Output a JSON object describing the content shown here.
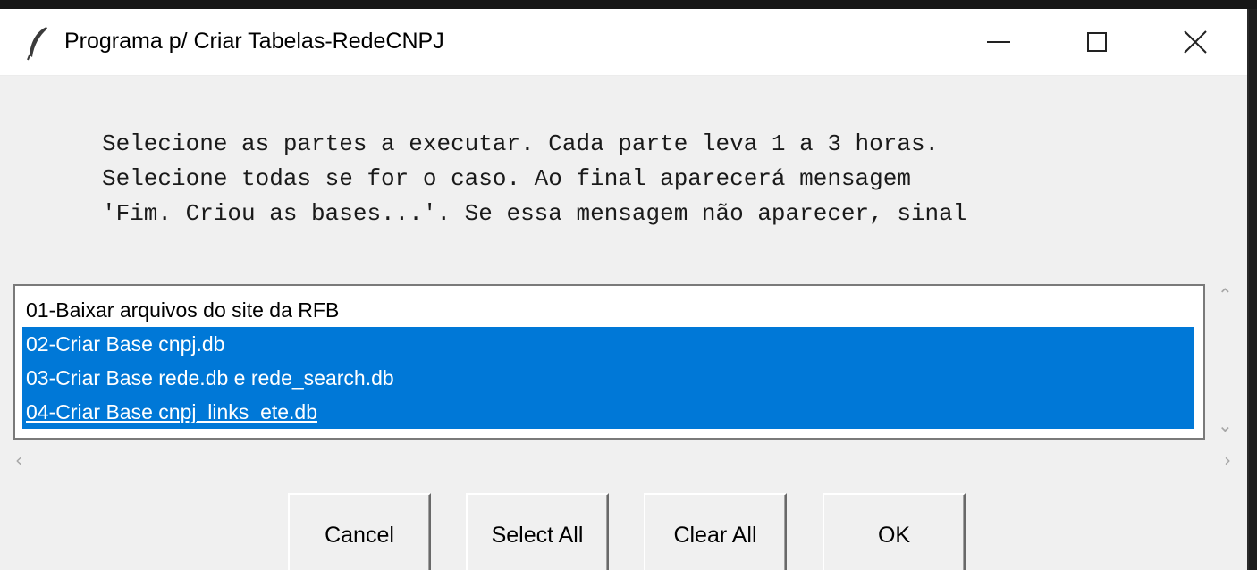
{
  "window": {
    "title": "Programa p/ Criar Tabelas-RedeCNPJ",
    "icon": "feather-icon",
    "controls": [
      "minimize-icon",
      "maximize-icon",
      "close-icon"
    ]
  },
  "message": {
    "lines": [
      "Selecione as partes a executar. Cada parte leva 1 a 3 horas.",
      "Selecione todas se for o caso. Ao final aparecerá mensagem",
      "'Fim. Criou as bases...'. Se essa mensagem não aparecer, sinal"
    ]
  },
  "listbox": {
    "items": [
      {
        "label": "01-Baixar arquivos do site da RFB",
        "selected": false
      },
      {
        "label": "02-Criar Base cnpj.db",
        "selected": true
      },
      {
        "label": "03-Criar Base rede.db e rede_search.db",
        "selected": true
      },
      {
        "label": "04-Criar Base cnpj_links_ete.db",
        "selected": true,
        "focused": true
      }
    ]
  },
  "buttons": {
    "cancel": "Cancel",
    "select_all": "Select All",
    "clear_all": "Clear All",
    "ok": "OK"
  },
  "colors": {
    "selection": "#0078d7",
    "window_bg": "#f0f0f0"
  }
}
